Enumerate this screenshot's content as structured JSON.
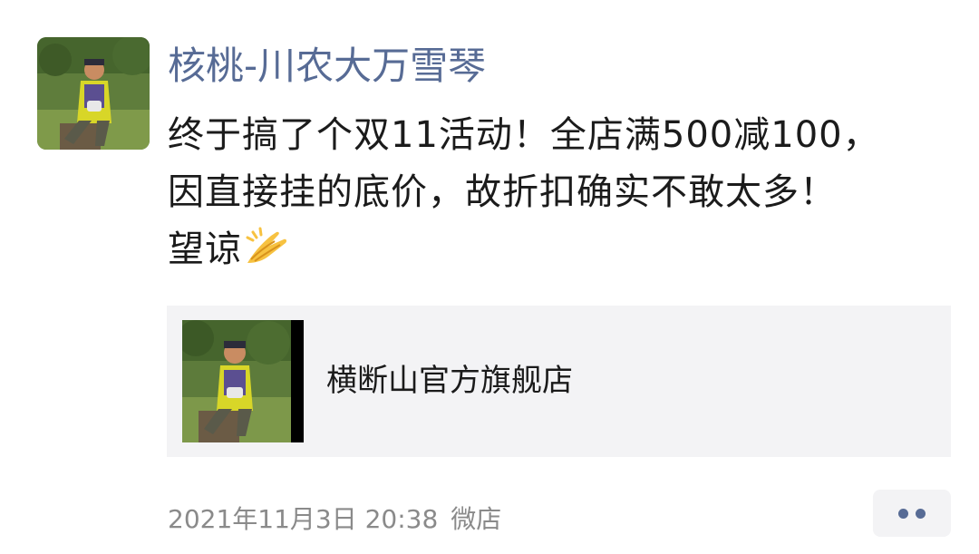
{
  "post": {
    "author": "核桃-川农大万雪琴",
    "text_lines": [
      "终于搞了个双11活动！全店满500减100，",
      "因直接挂的底价，故折扣确实不敢太多！",
      "望谅"
    ],
    "emoji": "hands-pressed-together-icon",
    "share_card": {
      "title": "横断山官方旗舰店",
      "thumbnail": "person-outdoors-photo"
    },
    "timestamp": "2021年11月3日 20:38",
    "source": "微店",
    "more_icon": "more-dots-icon"
  },
  "colors": {
    "name_link": "#576b95",
    "card_background": "#f3f3f5",
    "meta_text": "#8a8a8a"
  }
}
